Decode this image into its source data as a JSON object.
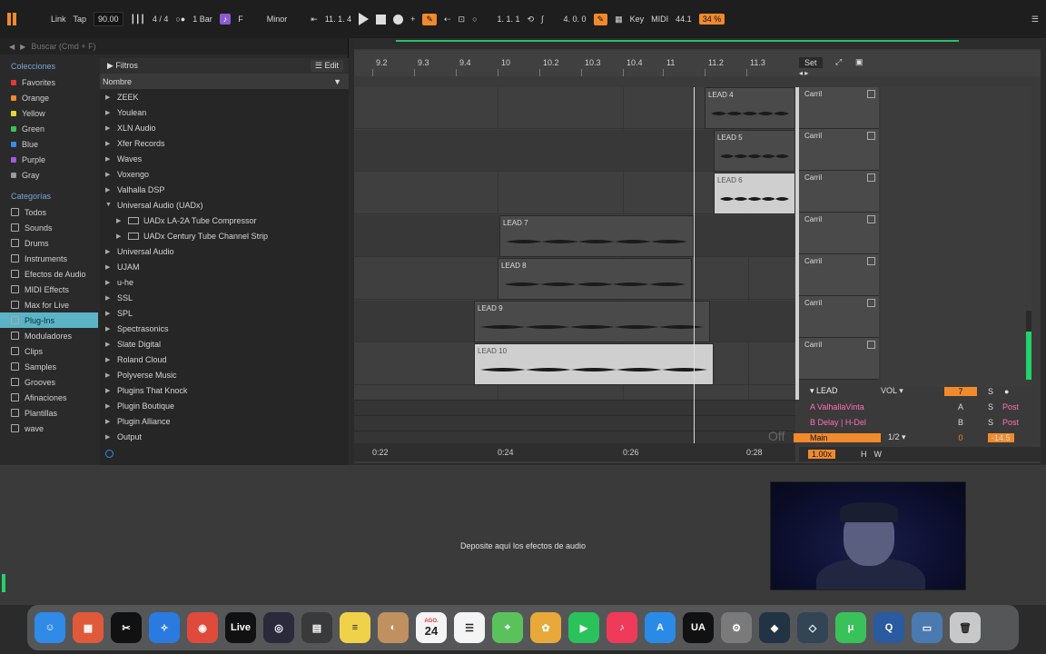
{
  "topbar": {
    "link": "Link",
    "tap": "Tap",
    "tempo": "90.00",
    "time_sig": "4 / 4",
    "quantize": "1 Bar",
    "key": "F",
    "scale": "Minor",
    "position": "11.  1.  4",
    "loop_start": "1.  1.  1",
    "loop_len": "4.  0.  0",
    "key_btn": "Key",
    "midi_btn": "MIDI",
    "cpu": "44.1",
    "cpu_pct": "34 %"
  },
  "browser": {
    "search_placeholder": "Buscar (Cmd + F)",
    "collections_title": "Colecciones",
    "collections": [
      {
        "label": "Favorites",
        "color": "#e03a3a"
      },
      {
        "label": "Orange",
        "color": "#f08a2c"
      },
      {
        "label": "Yellow",
        "color": "#e8d23a"
      },
      {
        "label": "Green",
        "color": "#3ac25a"
      },
      {
        "label": "Blue",
        "color": "#3a8ae8"
      },
      {
        "label": "Purple",
        "color": "#a05ae0"
      },
      {
        "label": "Gray",
        "color": "#9a9a9a"
      }
    ],
    "categories_title": "Categorías",
    "categories": [
      "Todos",
      "Sounds",
      "Drums",
      "Instruments",
      "Efectos de Audio",
      "MIDI Effects",
      "Max for Live",
      "Plug-Ins",
      "Moduladores",
      "Clips",
      "Samples",
      "Grooves",
      "Afinaciones",
      "Plantillas",
      "wave"
    ],
    "filters_label": "Filtros",
    "edit_label": "Edit",
    "name_header": "Nombre",
    "items": [
      "ZEEK",
      "Youlean",
      "XLN Audio",
      "Xfer Records",
      "Waves",
      "Voxengo",
      "Valhalla DSP",
      "Universal Audio (UADx)",
      "UADx LA-2A Tube Compressor",
      "UADx Century Tube Channel Strip",
      "Universal Audio",
      "UJAM",
      "u-he",
      "SSL",
      "SPL",
      "Spectrasonics",
      "Slate Digital",
      "Roland Cloud",
      "Polyverse Music",
      "Plugins That Knock",
      "Plugin Boutique",
      "Plugin Alliance",
      "Output"
    ]
  },
  "arrangement": {
    "ruler": [
      "9.2",
      "9.3",
      "9.4",
      "10",
      "10.2",
      "10.3",
      "10.4",
      "11",
      "11.2",
      "11.3"
    ],
    "set_label": "Set",
    "clips": [
      "LEAD 4",
      "LEAD 5",
      "LEAD 6",
      "LEAD 7",
      "LEAD 8",
      "LEAD 9",
      "LEAD 10"
    ],
    "slot_label": "Carril",
    "track_name": "LEAD",
    "vol_label": "VOL",
    "track_number": "7",
    "send_a": "A ValhallaVinta",
    "send_b": "B Delay | H-Del",
    "main": "Main",
    "main_ratio": "1/2",
    "a_btn": "A",
    "b_btn": "B",
    "s_btn": "S",
    "post": "Post",
    "zero": "0",
    "gain": "-14.5",
    "off": "Off",
    "time_ticks": [
      "0:22",
      "0:24",
      "0:26",
      "0:28"
    ],
    "zoom": "1.00x",
    "h_btn": "H",
    "w_btn": "W"
  },
  "device": {
    "drop_text": "Deposite aquí los efectos de audio"
  },
  "dock": {
    "apps": [
      {
        "name": "finder-icon",
        "color": "#2f8ae8",
        "glyph": "☺"
      },
      {
        "name": "launchpad-icon",
        "color": "#e05a3a",
        "glyph": "▦"
      },
      {
        "name": "capcut-icon",
        "color": "#111111",
        "glyph": "✂"
      },
      {
        "name": "safari-icon",
        "color": "#2a7ae0",
        "glyph": "✧"
      },
      {
        "name": "chrome-icon",
        "color": "#e04a3a",
        "glyph": "◉"
      },
      {
        "name": "ableton-live-icon",
        "color": "#111111",
        "glyph": "Live"
      },
      {
        "name": "obs-icon",
        "color": "#2a2a3a",
        "glyph": "◎"
      },
      {
        "name": "calculator-icon",
        "color": "#3a3a3a",
        "glyph": "▤"
      },
      {
        "name": "notes-icon",
        "color": "#f0d24a",
        "glyph": "≡"
      },
      {
        "name": "contacts-icon",
        "color": "#c09060",
        "glyph": "◐"
      },
      {
        "name": "calendar-icon",
        "color": "#f4f4f4",
        "glyph": "24"
      },
      {
        "name": "reminders-icon",
        "color": "#f4f4f4",
        "glyph": "☰"
      },
      {
        "name": "maps-icon",
        "color": "#5ac25a",
        "glyph": "⌖"
      },
      {
        "name": "photos-icon",
        "color": "#e8a83a",
        "glyph": "✿"
      },
      {
        "name": "facetime-icon",
        "color": "#2ac25a",
        "glyph": "▶"
      },
      {
        "name": "music-icon",
        "color": "#f03a5a",
        "glyph": "♪"
      },
      {
        "name": "app-store-icon",
        "color": "#2a8ae8",
        "glyph": "A"
      },
      {
        "name": "ua-connect-icon",
        "color": "#111111",
        "glyph": "UA"
      },
      {
        "name": "settings-icon",
        "color": "#7a7a7a",
        "glyph": "⚙"
      },
      {
        "name": "plugin-app-icon",
        "color": "#223344",
        "glyph": "◆"
      },
      {
        "name": "plugin-app2-icon",
        "color": "#334455",
        "glyph": "◇"
      },
      {
        "name": "utorrent-icon",
        "color": "#3ac25a",
        "glyph": "μ"
      },
      {
        "name": "quicktime-icon",
        "color": "#2a5aa0",
        "glyph": "Q"
      },
      {
        "name": "preview-icon",
        "color": "#4a7ab0",
        "glyph": "▭"
      },
      {
        "name": "trash-icon",
        "color": "#c8c8c8",
        "glyph": "🗑"
      }
    ],
    "calendar_month": "AGO."
  }
}
